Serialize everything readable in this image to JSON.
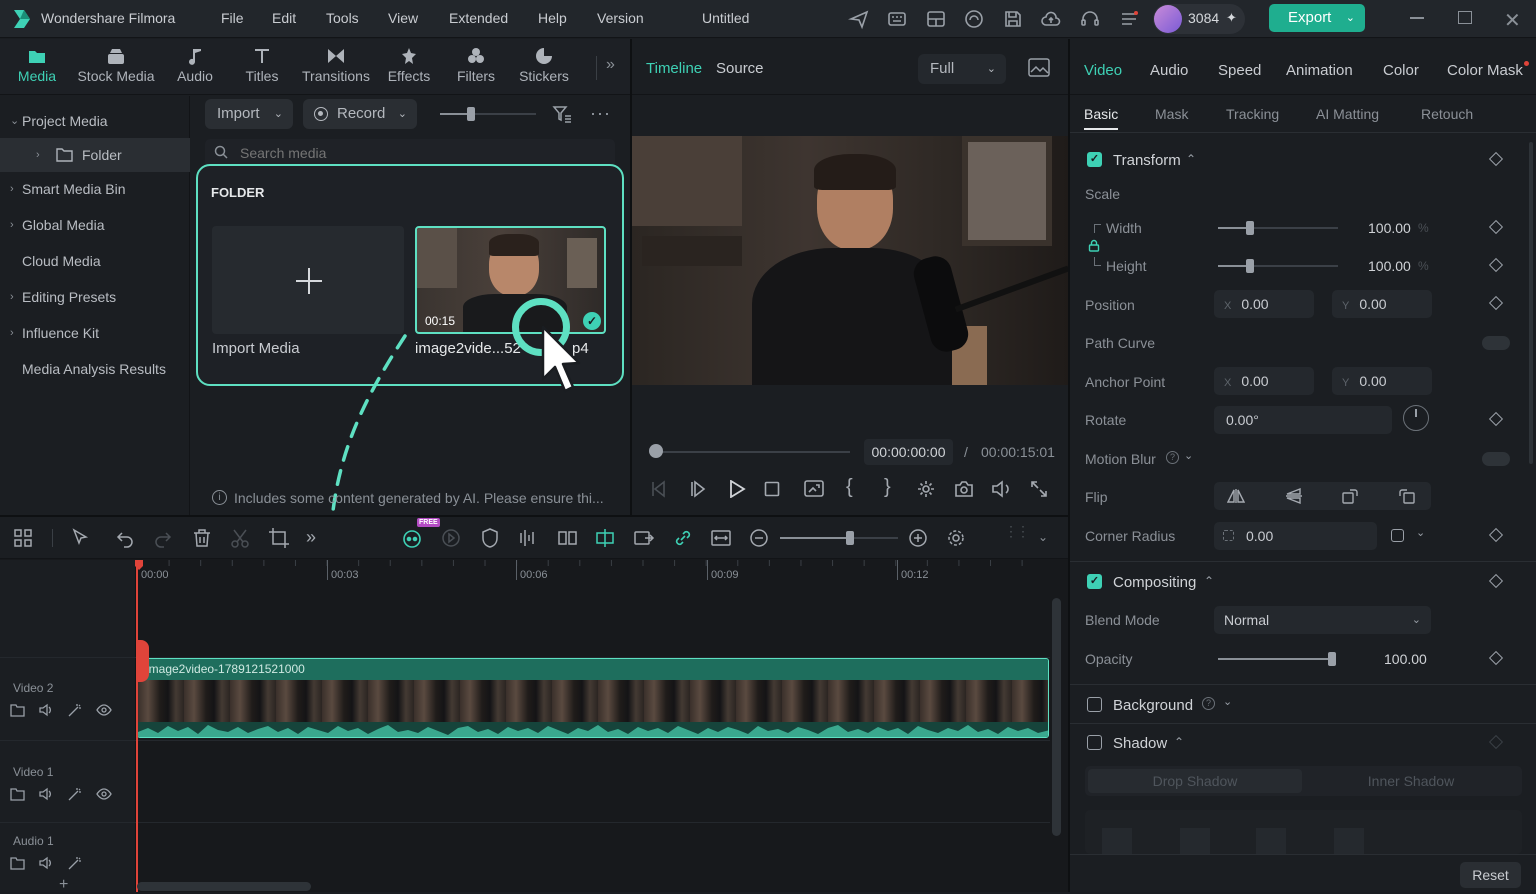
{
  "app": {
    "name": "Wondershare Filmora",
    "project_title": "Untitled",
    "credits": "3084",
    "export_label": "Export"
  },
  "menu": [
    "File",
    "Edit",
    "Tools",
    "View",
    "Extended",
    "Help",
    "Version"
  ],
  "media_tabs": [
    {
      "label": "Media",
      "icon": "media-icon"
    },
    {
      "label": "Stock Media",
      "icon": "stock-media-icon"
    },
    {
      "label": "Audio",
      "icon": "audio-icon"
    },
    {
      "label": "Titles",
      "icon": "titles-icon"
    },
    {
      "label": "Transitions",
      "icon": "transitions-icon"
    },
    {
      "label": "Effects",
      "icon": "effects-icon"
    },
    {
      "label": "Filters",
      "icon": "filters-icon"
    },
    {
      "label": "Stickers",
      "icon": "stickers-icon"
    }
  ],
  "sidebar": {
    "items": [
      {
        "label": "Project Media",
        "expanded": true
      },
      {
        "label": "Folder",
        "child": true
      },
      {
        "label": "Smart Media Bin"
      },
      {
        "label": "Global Media"
      },
      {
        "label": "Cloud Media"
      },
      {
        "label": "Editing Presets"
      },
      {
        "label": "Influence Kit"
      },
      {
        "label": "Media Analysis Results"
      }
    ]
  },
  "library": {
    "import_label": "Import",
    "record_label": "Record",
    "search_placeholder": "Search media",
    "folder_heading": "FOLDER",
    "import_media_label": "Import Media",
    "clip_name": "image2vide...52",
    "clip_ext": "p4",
    "clip_duration": "00:15",
    "notice": "Includes some content generated by AI. Please ensure thi..."
  },
  "player": {
    "tabs": [
      "Timeline",
      "Source"
    ],
    "quality": "Full",
    "current_time": "00:00:00:00",
    "separator": "/",
    "total_time": "00:00:15:01"
  },
  "inspector": {
    "main_tabs": [
      "Video",
      "Audio",
      "Speed",
      "Animation",
      "Color",
      "Color Mask"
    ],
    "sub_tabs": [
      "Basic",
      "Mask",
      "Tracking",
      "AI Matting",
      "Retouch"
    ],
    "transform": {
      "heading": "Transform",
      "scale_label": "Scale",
      "width_label": "Width",
      "width_value": "100.00",
      "height_label": "Height",
      "height_value": "100.00",
      "unit": "%",
      "position_label": "Position",
      "position_x": "0.00",
      "position_y": "0.00",
      "path_curve_label": "Path Curve",
      "anchor_label": "Anchor Point",
      "anchor_x": "0.00",
      "anchor_y": "0.00",
      "rotate_label": "Rotate",
      "rotate_value": "0.00°",
      "motion_blur_label": "Motion Blur",
      "flip_label": "Flip",
      "corner_label": "Corner Radius",
      "corner_value": "0.00",
      "x_axis": "X",
      "y_axis": "Y"
    },
    "compositing": {
      "heading": "Compositing",
      "blend_label": "Blend Mode",
      "blend_value": "Normal",
      "opacity_label": "Opacity",
      "opacity_value": "100.00"
    },
    "background_label": "Background",
    "shadow": {
      "heading": "Shadow",
      "tabs": [
        "Drop Shadow",
        "Inner Shadow"
      ]
    },
    "reset_label": "Reset"
  },
  "timeline": {
    "ruler": [
      "00:00",
      "00:03",
      "00:06",
      "00:09",
      "00:12"
    ],
    "clip_title": "image2video-1789121521000",
    "tracks": [
      "Video 2",
      "Video 1",
      "Audio 1"
    ],
    "free_badge": "FREE"
  },
  "colors": {
    "accent": "#3ed1b5",
    "export_bg": "#1fae8f",
    "clip_bg": "#1f6b5b",
    "playhead": "#e0443a"
  }
}
